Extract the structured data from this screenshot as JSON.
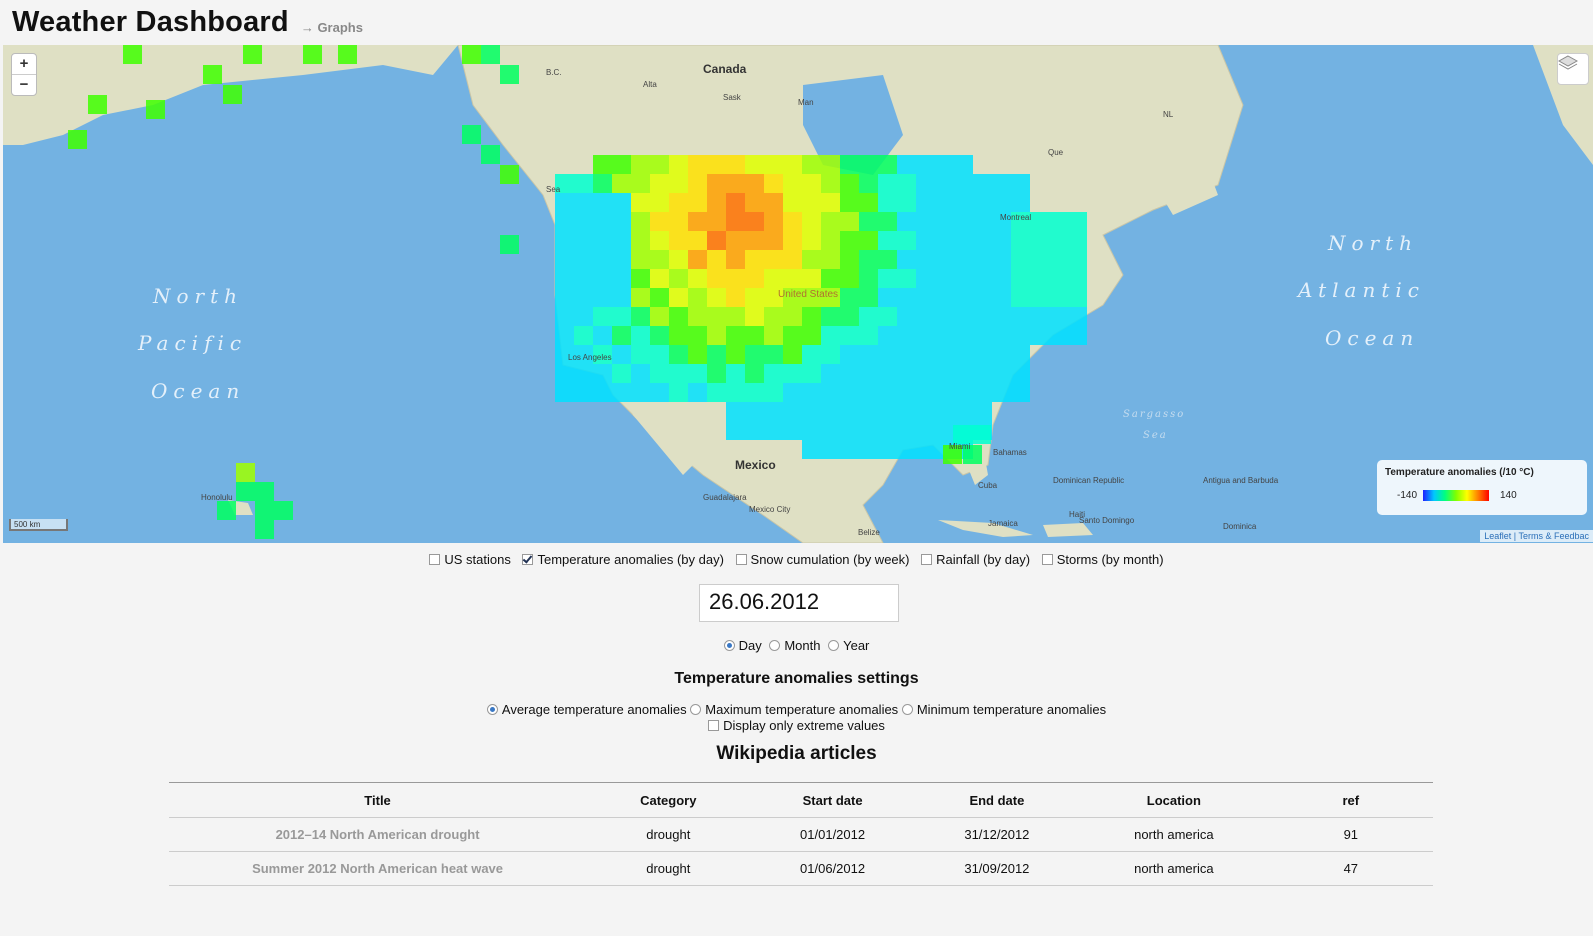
{
  "header": {
    "title": "Weather Dashboard",
    "graphs_link": "→ Graphs"
  },
  "map": {
    "zoom_in": "+",
    "zoom_out": "−",
    "scale_label": "500 km",
    "attribution": "Leaflet | Terms & Feedbac",
    "ocean_labels": {
      "pacific": [
        "North",
        "Pacific",
        "Ocean"
      ],
      "atlantic": [
        "North",
        "Atlantic",
        "Ocean"
      ],
      "sargasso": [
        "Sargasso",
        "Sea"
      ]
    },
    "countries": {
      "canada": "Canada",
      "mexico": "Mexico",
      "us": "United States"
    },
    "cities": {
      "seattle": "Sea",
      "montreal": "Montreal",
      "los_angeles": "Los Angeles",
      "honolulu": "Honolulu",
      "guadalajara": "Guadalajara",
      "mexico_city": "Mexico City",
      "cuba": "Cuba",
      "miami": "Miami",
      "bahamas": "Bahamas",
      "dominican": "Dominican Republic",
      "haiti": "Haiti",
      "santo_domingo": "Santo Domingo",
      "jamaica": "Jamaica",
      "antigua": "Antigua and Barbuda",
      "dominica": "Dominica",
      "belize": "Belize",
      "bc": "B.C.",
      "alta": "Alta",
      "sask": "Sask",
      "man": "Man",
      "que": "Que",
      "nl": "NL"
    },
    "legend": {
      "title": "Temperature anomalies (/10 °C)",
      "min": "-140",
      "max": "140"
    }
  },
  "layers": [
    {
      "label": "US stations",
      "checked": false
    },
    {
      "label": "Temperature anomalies (by day)",
      "checked": true
    },
    {
      "label": "Snow cumulation (by week)",
      "checked": false
    },
    {
      "label": "Rainfall (by day)",
      "checked": false
    },
    {
      "label": "Storms (by month)",
      "checked": false
    }
  ],
  "date": {
    "value": "26.06.2012"
  },
  "period": {
    "day": "Day",
    "month": "Month",
    "year": "Year",
    "selected": "day"
  },
  "settings": {
    "title": "Temperature anomalies settings",
    "average": "Average temperature anomalies",
    "maximum": "Maximum temperature anomalies",
    "minimum": "Minimum temperature anomalies",
    "selected": "average",
    "extreme": "Display only extreme values"
  },
  "wiki": {
    "title": "Wikipedia articles",
    "columns": [
      "Title",
      "Category",
      "Start date",
      "End date",
      "Location",
      "ref"
    ],
    "rows": [
      [
        "2012–14 North American drought",
        "drought",
        "01/01/2012",
        "31/12/2012",
        "north america",
        "91"
      ],
      [
        "Summer 2012 North American heat wave",
        "drought",
        "01/06/2012",
        "31/09/2012",
        "north america",
        "47"
      ]
    ]
  }
}
